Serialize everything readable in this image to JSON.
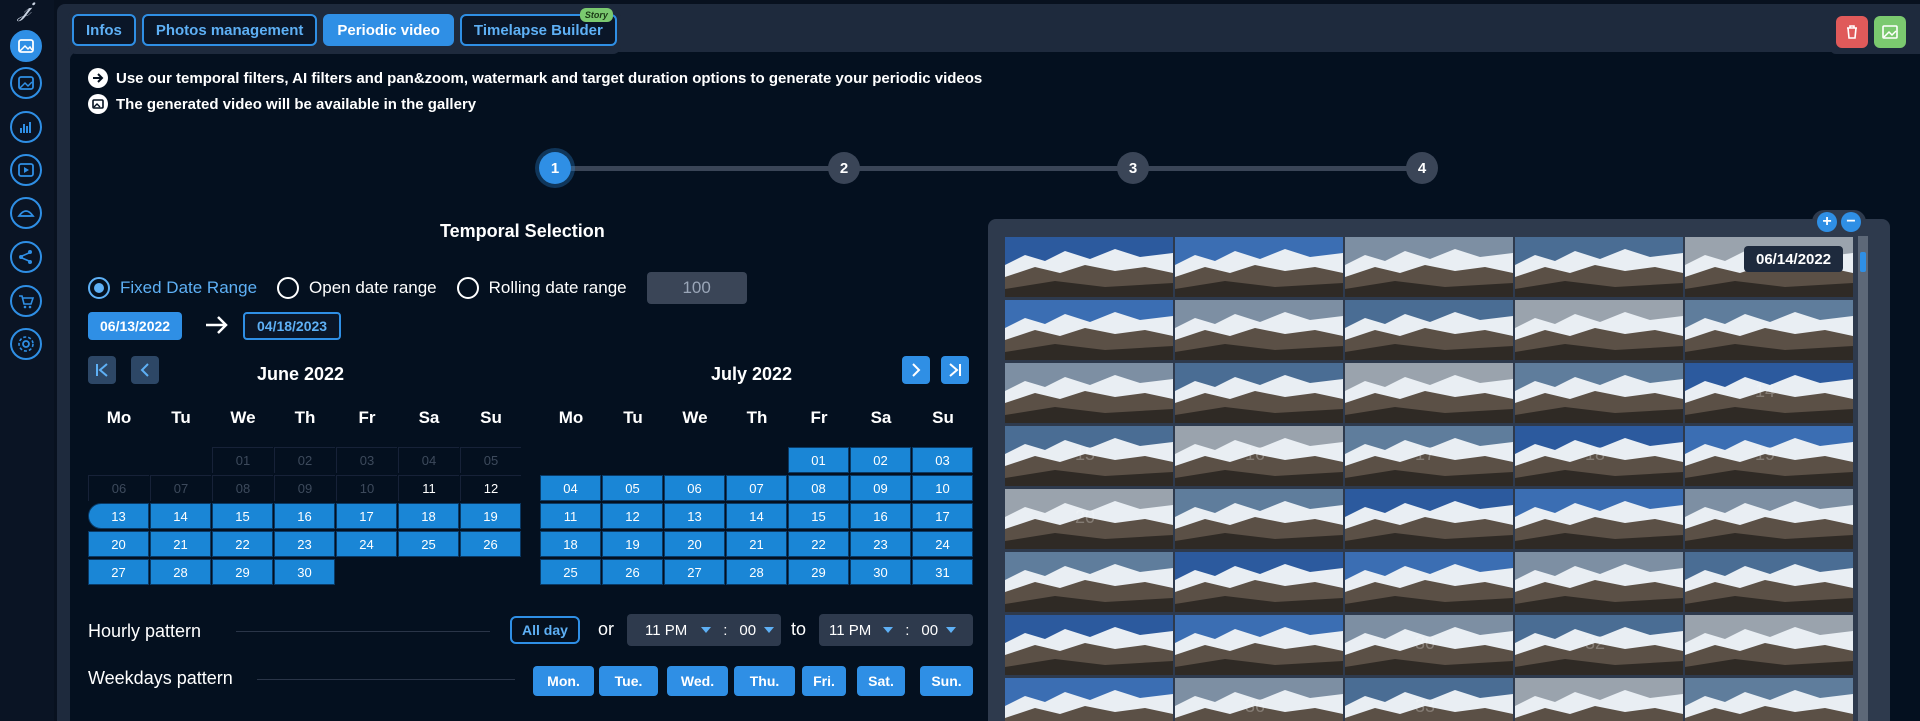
{
  "tabs": [
    {
      "label": "Infos",
      "active": false
    },
    {
      "label": "Photos management",
      "active": false
    },
    {
      "label": "Periodic video",
      "active": true
    },
    {
      "label": "Timelapse Builder",
      "active": false,
      "badge": "Story"
    }
  ],
  "info_lines": [
    "Use our temporal filters, AI filters and pan&zoom, watermark and target duration options to generate your periodic videos",
    "The generated video will be available in the gallery"
  ],
  "steps": [
    "1",
    "2",
    "3",
    "4"
  ],
  "active_step": 1,
  "temporal": {
    "title": "Temporal Selection",
    "range_options": [
      "Fixed Date Range",
      "Open date range",
      "Rolling date range"
    ],
    "selected_range": "Fixed Date Range",
    "rolling_value": "100",
    "date_from": "06/13/2022",
    "date_to": "04/18/2023"
  },
  "calendar": {
    "weekdays": [
      "Mo",
      "Tu",
      "We",
      "Th",
      "Fr",
      "Sa",
      "Su"
    ],
    "months": [
      {
        "title": "June 2022",
        "days": [
          {
            "d": "",
            "t": "empty"
          },
          {
            "d": "",
            "t": "empty"
          },
          {
            "d": "01",
            "t": "out"
          },
          {
            "d": "02",
            "t": "out"
          },
          {
            "d": "03",
            "t": "out"
          },
          {
            "d": "04",
            "t": "out"
          },
          {
            "d": "05",
            "t": "out"
          },
          {
            "d": "06",
            "t": "out"
          },
          {
            "d": "07",
            "t": "out"
          },
          {
            "d": "08",
            "t": "out"
          },
          {
            "d": "09",
            "t": "out"
          },
          {
            "d": "10",
            "t": "out"
          },
          {
            "d": "11",
            "t": "plain"
          },
          {
            "d": "12",
            "t": "plain"
          },
          {
            "d": "13",
            "t": "start"
          },
          {
            "d": "14",
            "t": "sel"
          },
          {
            "d": "15",
            "t": "sel"
          },
          {
            "d": "16",
            "t": "sel"
          },
          {
            "d": "17",
            "t": "sel"
          },
          {
            "d": "18",
            "t": "sel"
          },
          {
            "d": "19",
            "t": "sel"
          },
          {
            "d": "20",
            "t": "sel"
          },
          {
            "d": "21",
            "t": "sel"
          },
          {
            "d": "22",
            "t": "sel"
          },
          {
            "d": "23",
            "t": "sel"
          },
          {
            "d": "24",
            "t": "sel"
          },
          {
            "d": "25",
            "t": "sel"
          },
          {
            "d": "26",
            "t": "sel"
          },
          {
            "d": "27",
            "t": "sel"
          },
          {
            "d": "28",
            "t": "sel"
          },
          {
            "d": "29",
            "t": "sel"
          },
          {
            "d": "30",
            "t": "sel"
          }
        ]
      },
      {
        "title": "July 2022",
        "days": [
          {
            "d": "",
            "t": "empty"
          },
          {
            "d": "",
            "t": "empty"
          },
          {
            "d": "",
            "t": "empty"
          },
          {
            "d": "",
            "t": "empty"
          },
          {
            "d": "01",
            "t": "sel"
          },
          {
            "d": "02",
            "t": "sel"
          },
          {
            "d": "03",
            "t": "sel"
          },
          {
            "d": "04",
            "t": "sel"
          },
          {
            "d": "05",
            "t": "sel"
          },
          {
            "d": "06",
            "t": "sel"
          },
          {
            "d": "07",
            "t": "sel"
          },
          {
            "d": "08",
            "t": "sel"
          },
          {
            "d": "09",
            "t": "sel"
          },
          {
            "d": "10",
            "t": "sel"
          },
          {
            "d": "11",
            "t": "sel"
          },
          {
            "d": "12",
            "t": "sel"
          },
          {
            "d": "13",
            "t": "sel"
          },
          {
            "d": "14",
            "t": "sel"
          },
          {
            "d": "15",
            "t": "sel"
          },
          {
            "d": "16",
            "t": "sel"
          },
          {
            "d": "17",
            "t": "sel"
          },
          {
            "d": "18",
            "t": "sel"
          },
          {
            "d": "19",
            "t": "sel"
          },
          {
            "d": "20",
            "t": "sel"
          },
          {
            "d": "21",
            "t": "sel"
          },
          {
            "d": "22",
            "t": "sel"
          },
          {
            "d": "23",
            "t": "sel"
          },
          {
            "d": "24",
            "t": "sel"
          },
          {
            "d": "25",
            "t": "sel"
          },
          {
            "d": "26",
            "t": "sel"
          },
          {
            "d": "27",
            "t": "sel"
          },
          {
            "d": "28",
            "t": "sel"
          },
          {
            "d": "29",
            "t": "sel"
          },
          {
            "d": "30",
            "t": "sel"
          },
          {
            "d": "31",
            "t": "sel"
          }
        ]
      }
    ]
  },
  "hourly": {
    "label": "Hourly pattern",
    "all_day": "All day",
    "or": "or",
    "to": "to",
    "from_hour": "11 PM",
    "from_min": "00",
    "to_hour": "11 PM",
    "to_min": "00",
    "sep": ":"
  },
  "weekdays_pattern": {
    "label": "Weekdays pattern",
    "days": [
      "Mon.",
      "Tue.",
      "Wed.",
      "Thu.",
      "Fri.",
      "Sat.",
      "Sun."
    ]
  },
  "gallery": {
    "date_tooltip": "06/14/2022",
    "zoom_in": "+",
    "zoom_out": "−",
    "visible_numbers": [
      "14",
      "15",
      "16",
      "17",
      "18",
      "19",
      "20",
      "30",
      "32",
      "33",
      "36"
    ]
  },
  "colors": {
    "accent": "#2f8fe5",
    "background": "#04101f",
    "delete": "#e05a5a",
    "gallery_button": "#7bc96f"
  },
  "rail_icons": [
    "image-icon",
    "gallery-icon",
    "chart-icon",
    "video-icon",
    "timelapse-icon",
    "share-icon",
    "cart-icon",
    "settings-icon"
  ]
}
